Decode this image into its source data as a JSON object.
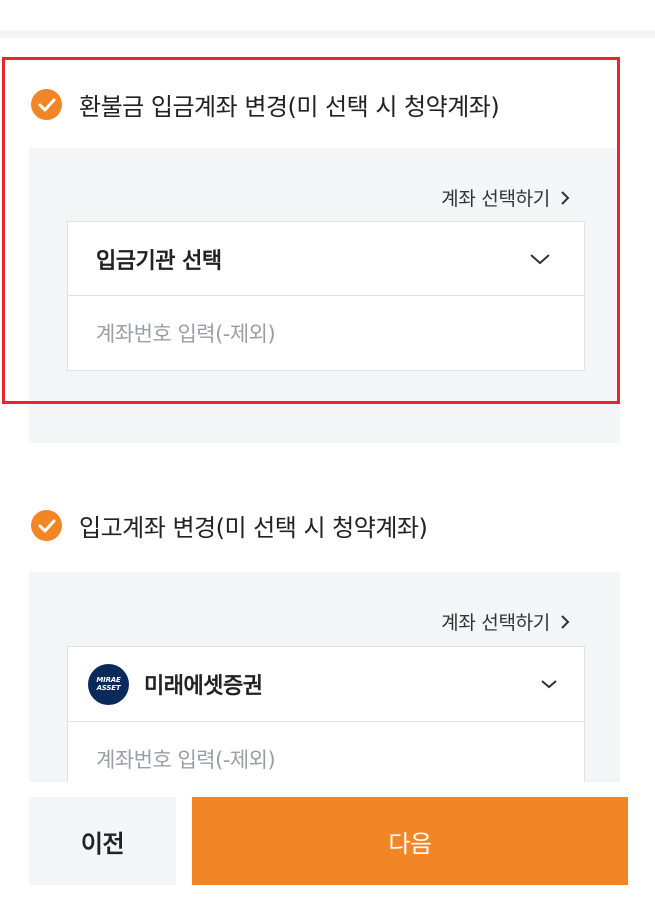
{
  "refund_section": {
    "title": "환불금 입금계좌 변경(미 선택 시 청약계좌)",
    "select_account_link": "계좌 선택하기",
    "institution_select": "입금기관 선택",
    "account_input_placeholder": "계좌번호 입력(-제외)"
  },
  "stock_section": {
    "title": "입고계좌 변경(미 선택 시 청약계좌)",
    "select_account_link": "계좌 선택하기",
    "bank_logo_text": [
      "MIRAE",
      "ASSET"
    ],
    "institution_selected": "미래에셋증권",
    "account_input_placeholder": "계좌번호 입력(-제외)"
  },
  "footer": {
    "prev_label": "이전",
    "next_label": "다음"
  },
  "colors": {
    "accent": "#f28526",
    "highlight_border": "#e8262e",
    "panel_bg": "#f4f5f7",
    "placeholder": "#9a9ea5"
  }
}
